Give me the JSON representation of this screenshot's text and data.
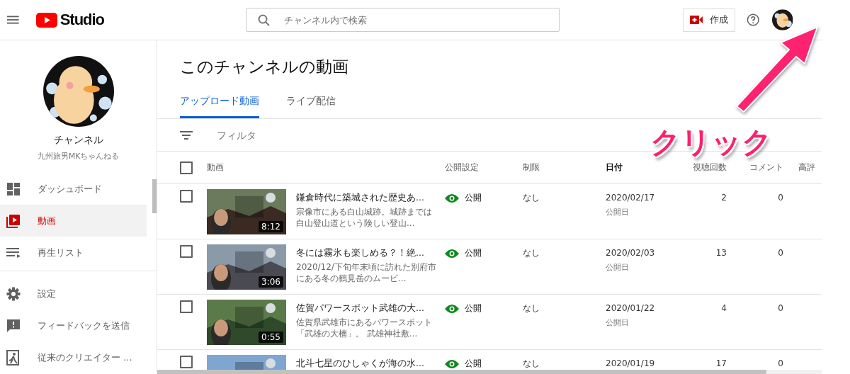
{
  "header": {
    "logo_text": "Studio",
    "search": {
      "placeholder": "チャンネル内で検索"
    },
    "create_button": "作成"
  },
  "sidebar": {
    "channel_label": "チャンネル",
    "channel_name": "九州旅男MKちゃんねる",
    "items": [
      {
        "label": "ダッシュボード",
        "kind": "dashboard",
        "selected": false
      },
      {
        "label": "動画",
        "kind": "videos",
        "selected": true
      },
      {
        "label": "再生リスト",
        "kind": "playlist",
        "selected": false
      },
      {
        "label": "設定",
        "kind": "settings",
        "selected": false
      },
      {
        "label": "フィードバックを送信",
        "kind": "feedback",
        "selected": false
      },
      {
        "label": "従来のクリエイター ...",
        "kind": "exit",
        "selected": false
      }
    ]
  },
  "page_title": "このチャンネルの動画",
  "tabs": [
    {
      "label": "アップロード動画",
      "selected": true
    },
    {
      "label": "ライブ配信",
      "selected": false
    }
  ],
  "filter": {
    "placeholder": "フィルタ"
  },
  "table": {
    "header_checked": false,
    "columns": [
      "動画",
      "公開設定",
      "制限",
      "日付",
      "視聴回数",
      "コメント",
      "高評"
    ],
    "rows": [
      {
        "checked": false,
        "title": "鎌倉時代に築城された歴史あ...",
        "description": "宗像市にある白山城跡。城跡までは白山登山道という険しい登山...",
        "duration": "8:12",
        "visibility": "公開",
        "restriction": "なし",
        "date": "2020/02/17",
        "date_label": "公開日",
        "views": "2",
        "comments": "0"
      },
      {
        "checked": false,
        "title": "冬には霧氷も楽しめる？！絶...",
        "description": "2020/12/下旬年末頃に訪れた別府市にある冬の鶴見岳のムービ...",
        "duration": "3:06",
        "visibility": "公開",
        "restriction": "なし",
        "date": "2020/02/03",
        "date_label": "公開日",
        "views": "13",
        "comments": "0"
      },
      {
        "checked": false,
        "title": "佐賀パワースポット武雄の大...",
        "description": "佐賀県武雄市にあるパワースポット「武雄の大楠」。 武雄神社敷...",
        "duration": "0:55",
        "visibility": "公開",
        "restriction": "なし",
        "date": "2020/01/22",
        "date_label": "公開日",
        "views": "4",
        "comments": "0"
      },
      {
        "checked": false,
        "title": "北斗七星のひしゃくが海の水...",
        "visibility": "公開",
        "restriction": "なし",
        "date": "2020/01/19",
        "views": "17",
        "comments": "0"
      }
    ]
  },
  "annotation": {
    "text": "クリック"
  }
}
